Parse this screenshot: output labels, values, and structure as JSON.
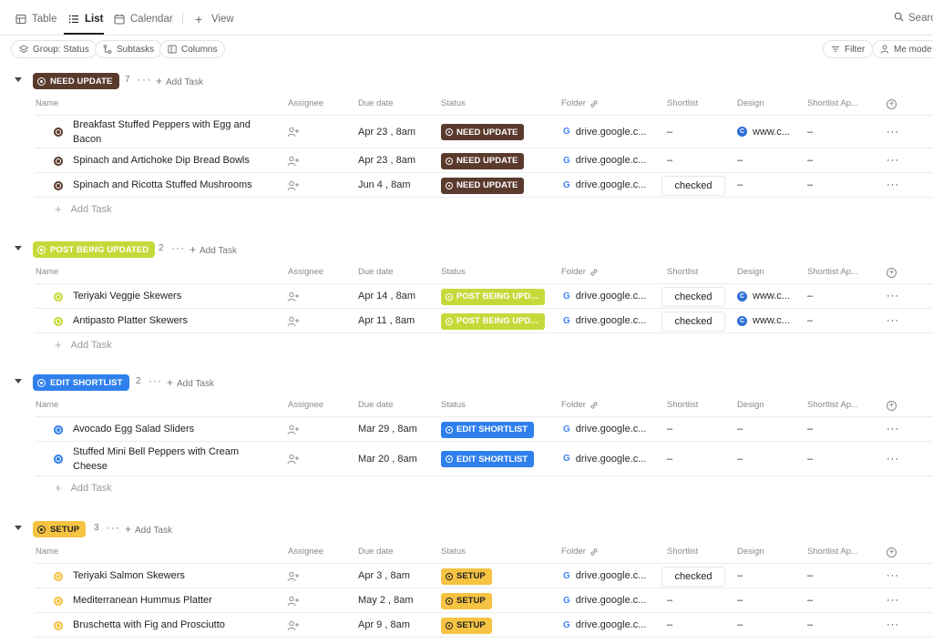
{
  "views": {
    "table": "Table",
    "list": "List",
    "calendar": "Calendar",
    "add_view": "View",
    "search": "Search"
  },
  "toolbar": {
    "group": "Group: Status",
    "subtasks": "Subtasks",
    "columns": "Columns",
    "filter": "Filter",
    "me_mode": "Me mode"
  },
  "columns": {
    "name": "Name",
    "assignee": "Assignee",
    "due": "Due date",
    "status": "Status",
    "folder": "Folder",
    "shortlist": "Shortlist",
    "design": "Design",
    "shortlist_ap": "Shortlist Ap..."
  },
  "add_task": "Add Task",
  "dash": "–",
  "more": "···",
  "colors": {
    "need_update": "#5b3a2e",
    "post_being_updated": "#c6d93a",
    "edit_shortlist": "#2f80ed",
    "setup": "#f6c342"
  },
  "groups": [
    {
      "label": "NEED UPDATE",
      "count": "7",
      "tasks": [
        {
          "name": "Breakfast Stuffed Peppers with Egg and Bacon",
          "due": "Apr 23 , 8am",
          "status": "NEED UPDATE",
          "folder": "drive.google.c...",
          "shortlist": "–",
          "design": "www.c...",
          "shortlist_ap": "–"
        },
        {
          "name": "Spinach and Artichoke Dip Bread Bowls",
          "due": "Apr 23 , 8am",
          "status": "NEED UPDATE",
          "folder": "drive.google.c...",
          "shortlist": "–",
          "design": "–",
          "shortlist_ap": "–"
        },
        {
          "name": "Spinach and Ricotta Stuffed Mushrooms",
          "due": "Jun 4 , 8am",
          "status": "NEED UPDATE",
          "folder": "drive.google.c...",
          "shortlist": "checked",
          "design": "–",
          "shortlist_ap": "–"
        }
      ]
    },
    {
      "label": "POST BEING UPDATED",
      "count": "2",
      "tasks": [
        {
          "name": "Teriyaki Veggie Skewers",
          "due": "Apr 14 , 8am",
          "status": "POST BEING UPD...",
          "folder": "drive.google.c...",
          "shortlist": "checked",
          "design": "www.c...",
          "shortlist_ap": "–"
        },
        {
          "name": "Antipasto Platter Skewers",
          "due": "Apr 11 , 8am",
          "status": "POST BEING UPD...",
          "folder": "drive.google.c...",
          "shortlist": "checked",
          "design": "www.c...",
          "shortlist_ap": "–"
        }
      ]
    },
    {
      "label": "EDIT SHORTLIST",
      "count": "2",
      "tasks": [
        {
          "name": "Avocado Egg Salad Sliders",
          "due": "Mar 29 , 8am",
          "status": "EDIT SHORTLIST",
          "folder": "drive.google.c...",
          "shortlist": "–",
          "design": "–",
          "shortlist_ap": "–"
        },
        {
          "name": "Stuffed Mini Bell Peppers with Cream Cheese",
          "due": "Mar 20 , 8am",
          "status": "EDIT SHORTLIST",
          "folder": "drive.google.c...",
          "shortlist": "–",
          "design": "–",
          "shortlist_ap": "–"
        }
      ]
    },
    {
      "label": "SETUP",
      "count": "3",
      "tasks": [
        {
          "name": "Teriyaki Salmon Skewers",
          "due": "Apr 3 , 8am",
          "status": "SETUP",
          "folder": "drive.google.c...",
          "shortlist": "checked",
          "design": "–",
          "shortlist_ap": "–"
        },
        {
          "name": "Mediterranean Hummus Platter",
          "due": "May 2 , 8am",
          "status": "SETUP",
          "folder": "drive.google.c...",
          "shortlist": "–",
          "design": "–",
          "shortlist_ap": "–"
        },
        {
          "name": "Bruschetta with Fig and Prosciutto",
          "due": "Apr 9 , 8am",
          "status": "SETUP",
          "folder": "drive.google.c...",
          "shortlist": "–",
          "design": "–",
          "shortlist_ap": "–"
        }
      ]
    }
  ]
}
